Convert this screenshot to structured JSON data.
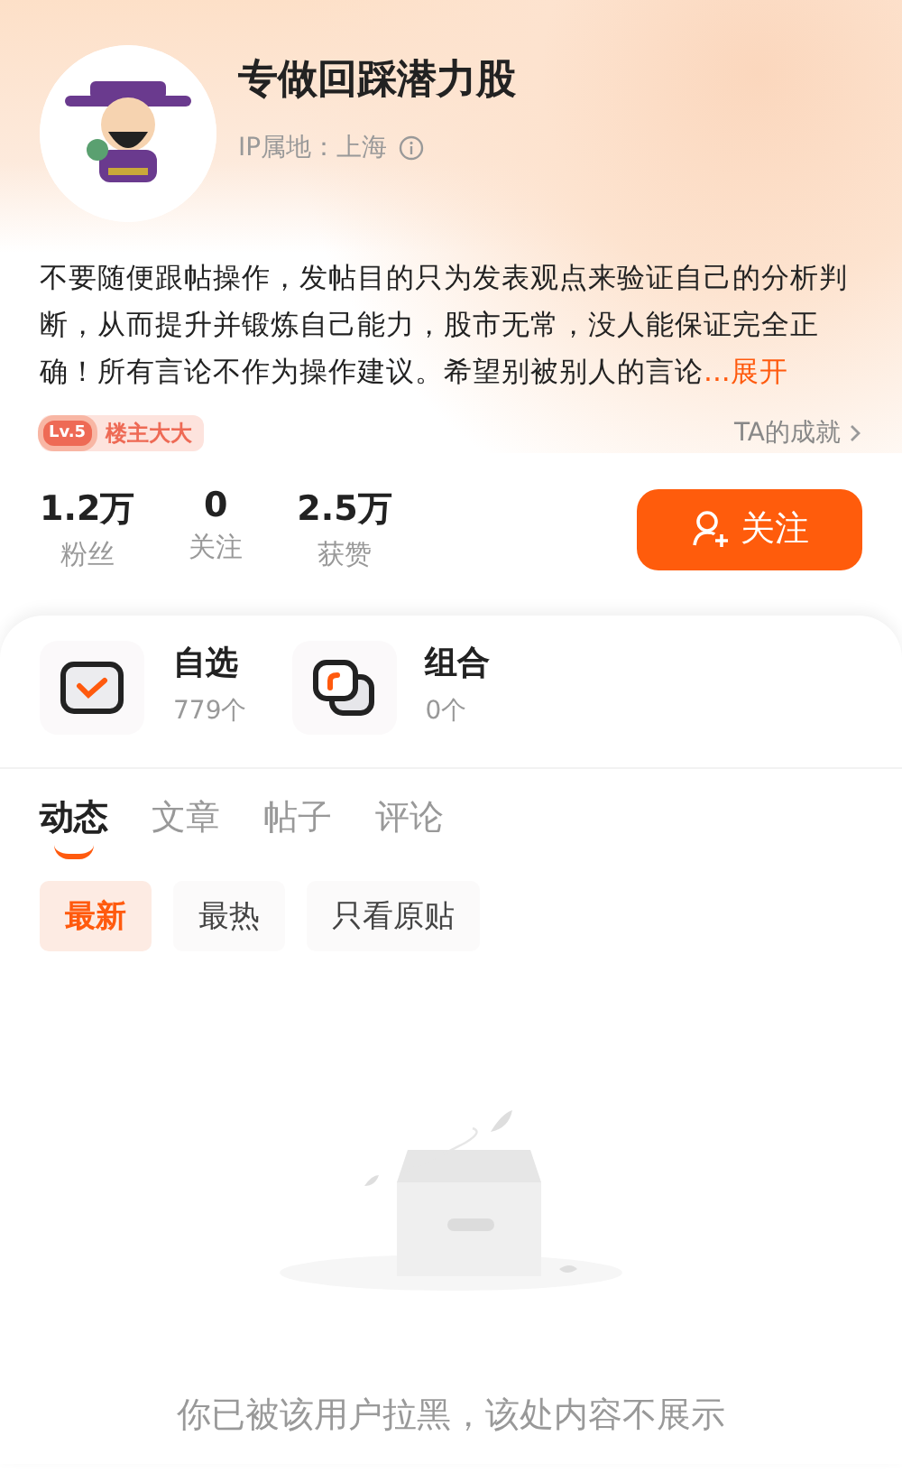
{
  "profile": {
    "name": "专做回踩潜力股",
    "ip": "IP属地：上海",
    "bio": "不要随便跟帖操作，发帖目的只为发表观点来验证自己的分析判断，从而提升并锻炼自己能力，股市无常，没人能保证完全正确！所有言论不作为操作建议。希望别被别人的言论",
    "expand": "...展开"
  },
  "badge": {
    "level": "Lv.5",
    "title": "楼主大大"
  },
  "achievements": "TA的成就",
  "stats": [
    {
      "value": "1.2万",
      "label": "粉丝"
    },
    {
      "value": "0",
      "label": "关注"
    },
    {
      "value": "2.5万",
      "label": "获赞"
    }
  ],
  "follow_button": "关注",
  "collections": [
    {
      "kind": "watchlist",
      "title": "自选",
      "count": "779个"
    },
    {
      "kind": "portfolio",
      "title": "组合",
      "count": "0个"
    }
  ],
  "tabs": [
    {
      "label": "动态",
      "selected": true
    },
    {
      "label": "文章",
      "selected": false
    },
    {
      "label": "帖子",
      "selected": false
    },
    {
      "label": "评论",
      "selected": false
    }
  ],
  "filters": [
    {
      "label": "最新",
      "selected": true
    },
    {
      "label": "最热",
      "selected": false
    },
    {
      "label": "只看原贴",
      "selected": false
    }
  ],
  "empty_message": "你已被该用户拉黑，该处内容不展示"
}
